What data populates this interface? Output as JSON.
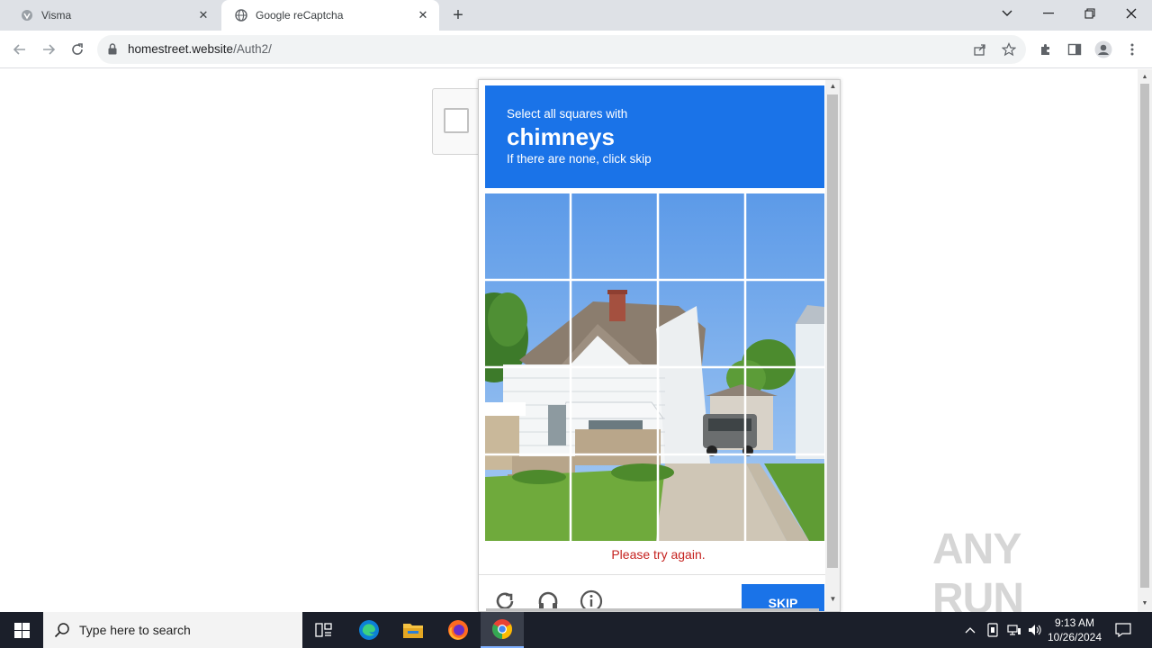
{
  "browser": {
    "tabs": [
      {
        "title": "Visma",
        "active": false
      },
      {
        "title": "Google reCaptcha",
        "active": true
      }
    ],
    "url": {
      "host": "homestreet.website",
      "path": "/Auth2/"
    }
  },
  "captcha": {
    "instruction_line1": "Select all squares with",
    "target": "chimneys",
    "instruction_line3": "If there are none, click skip",
    "error": "Please try again.",
    "skip_label": "SKIP",
    "grid_size": 4,
    "colors": {
      "header": "#1a73e8",
      "error": "#c5221f",
      "button": "#1a73e8"
    }
  },
  "watermark": {
    "text": "ANY RUN"
  },
  "taskbar": {
    "search_placeholder": "Type here to search",
    "time": "9:13 AM",
    "date": "10/26/2024"
  }
}
